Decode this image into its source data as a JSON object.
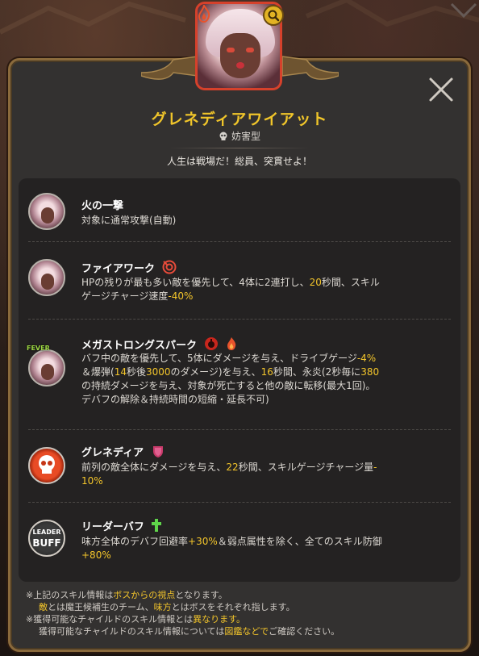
{
  "character": {
    "name": "グレネディアワイアット",
    "role": "妨害型",
    "tagline": "人生は戦場だ！総員、突貫せよ！"
  },
  "skills": [
    {
      "name": "火の一撃",
      "desc_lines": [
        "対象に通常攻撃(自動)"
      ],
      "icon": "character-portrait-icon"
    },
    {
      "name": "ファイアワーク",
      "badge": "target-debuff-icon",
      "desc_parts": [
        {
          "t": "HPの残りが最も多い敵を優先して、4体に2連打し、"
        },
        {
          "t": "20",
          "hl": true
        },
        {
          "t": "秒間、スキル"
        },
        {
          "br": true
        },
        {
          "t": "ゲージチャージ速度"
        },
        {
          "t": "-40%",
          "hl": true
        }
      ],
      "icon": "character-portrait-icon"
    },
    {
      "name": "メガストロングスパーク",
      "badges": [
        "bomb-debuff-icon",
        "fire-debuff-icon"
      ],
      "icon_label": "FEVER",
      "desc_parts": [
        {
          "t": "バフ中の敵を優先して、5体にダメージを与え、ドライブゲージ"
        },
        {
          "t": "-4%",
          "hl": true
        },
        {
          "br": true
        },
        {
          "t": "＆爆弾("
        },
        {
          "t": "14",
          "hl": true
        },
        {
          "t": "秒後"
        },
        {
          "t": "3000",
          "hl": true
        },
        {
          "t": "のダメージ)を与え、"
        },
        {
          "t": "16",
          "hl": true
        },
        {
          "t": "秒間、永炎(2秒毎に"
        },
        {
          "t": "380",
          "hl": true
        },
        {
          "br": true
        },
        {
          "t": "の持続ダメージを与え、対象が死亡すると他の敵に転移(最大1回)。"
        },
        {
          "br": true
        },
        {
          "t": "デバフの解除＆持続時間の短縮・延長不可)"
        }
      ],
      "icon": "character-portrait-icon"
    },
    {
      "name": "グレネディア",
      "badge": "shield-debuff-icon",
      "desc_parts": [
        {
          "t": "前列の敵全体にダメージを与え、"
        },
        {
          "t": "22",
          "hl": true
        },
        {
          "t": "秒間、スキルゲージチャージ量"
        },
        {
          "t": "-",
          "hl": true
        },
        {
          "br": true
        },
        {
          "t": "10%",
          "hl": true
        }
      ],
      "icon": "skull-icon"
    },
    {
      "name": "リーダーバフ",
      "badge": "green-cross-icon",
      "icon_label_top": "LEADER",
      "icon_label_bottom": "BUFF",
      "desc_parts": [
        {
          "t": "味方全体のデバフ回避率"
        },
        {
          "t": "+30%",
          "hl": true
        },
        {
          "t": "＆弱点属性を除く、全てのスキル防御"
        },
        {
          "br": true
        },
        {
          "t": "+80%",
          "hl": true
        }
      ],
      "icon": "leader-buff-icon"
    }
  ],
  "notes": {
    "line1_a": "※上記のスキル情報は",
    "line1_b": "ボスからの視点",
    "line1_c": "となります。",
    "line2_a": "敵",
    "line2_b": "とは魔王候補生のチーム、",
    "line2_c": "味方",
    "line2_d": "とはボスをそれぞれ指します。",
    "line3_a": "※獲得可能なチャイルドのスキル情報とは",
    "line3_b": "異なります。",
    "line4_a": "獲得可能なチャイルドのスキル情報については",
    "line4_b": "図鑑などで",
    "line4_c": "ご確認ください。"
  },
  "colors": {
    "accent": "#f3c52b",
    "title": "#f0c52a",
    "panel_border": "#8a6a3c",
    "portrait_border": "#d6412b"
  }
}
